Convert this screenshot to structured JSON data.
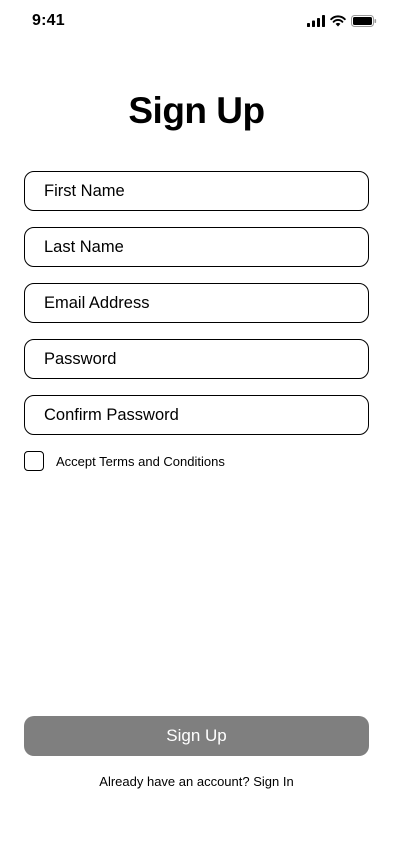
{
  "status_bar": {
    "time": "9:41",
    "icons": [
      "cellular-signal-icon",
      "wifi-icon",
      "battery-icon"
    ]
  },
  "title": "Sign Up",
  "fields": {
    "first_name": {
      "placeholder": "First Name",
      "value": ""
    },
    "last_name": {
      "placeholder": "Last Name",
      "value": ""
    },
    "email": {
      "placeholder": "Email Address",
      "value": ""
    },
    "password": {
      "placeholder": "Password",
      "value": ""
    },
    "confirm_password": {
      "placeholder": "Confirm Password",
      "value": ""
    }
  },
  "terms": {
    "label": "Accept Terms and Conditions",
    "checked": false
  },
  "submit_button": {
    "label": "Sign Up",
    "color": "#7f7f7f"
  },
  "signin": {
    "prompt": "Already have an account?",
    "link": "Sign In"
  }
}
